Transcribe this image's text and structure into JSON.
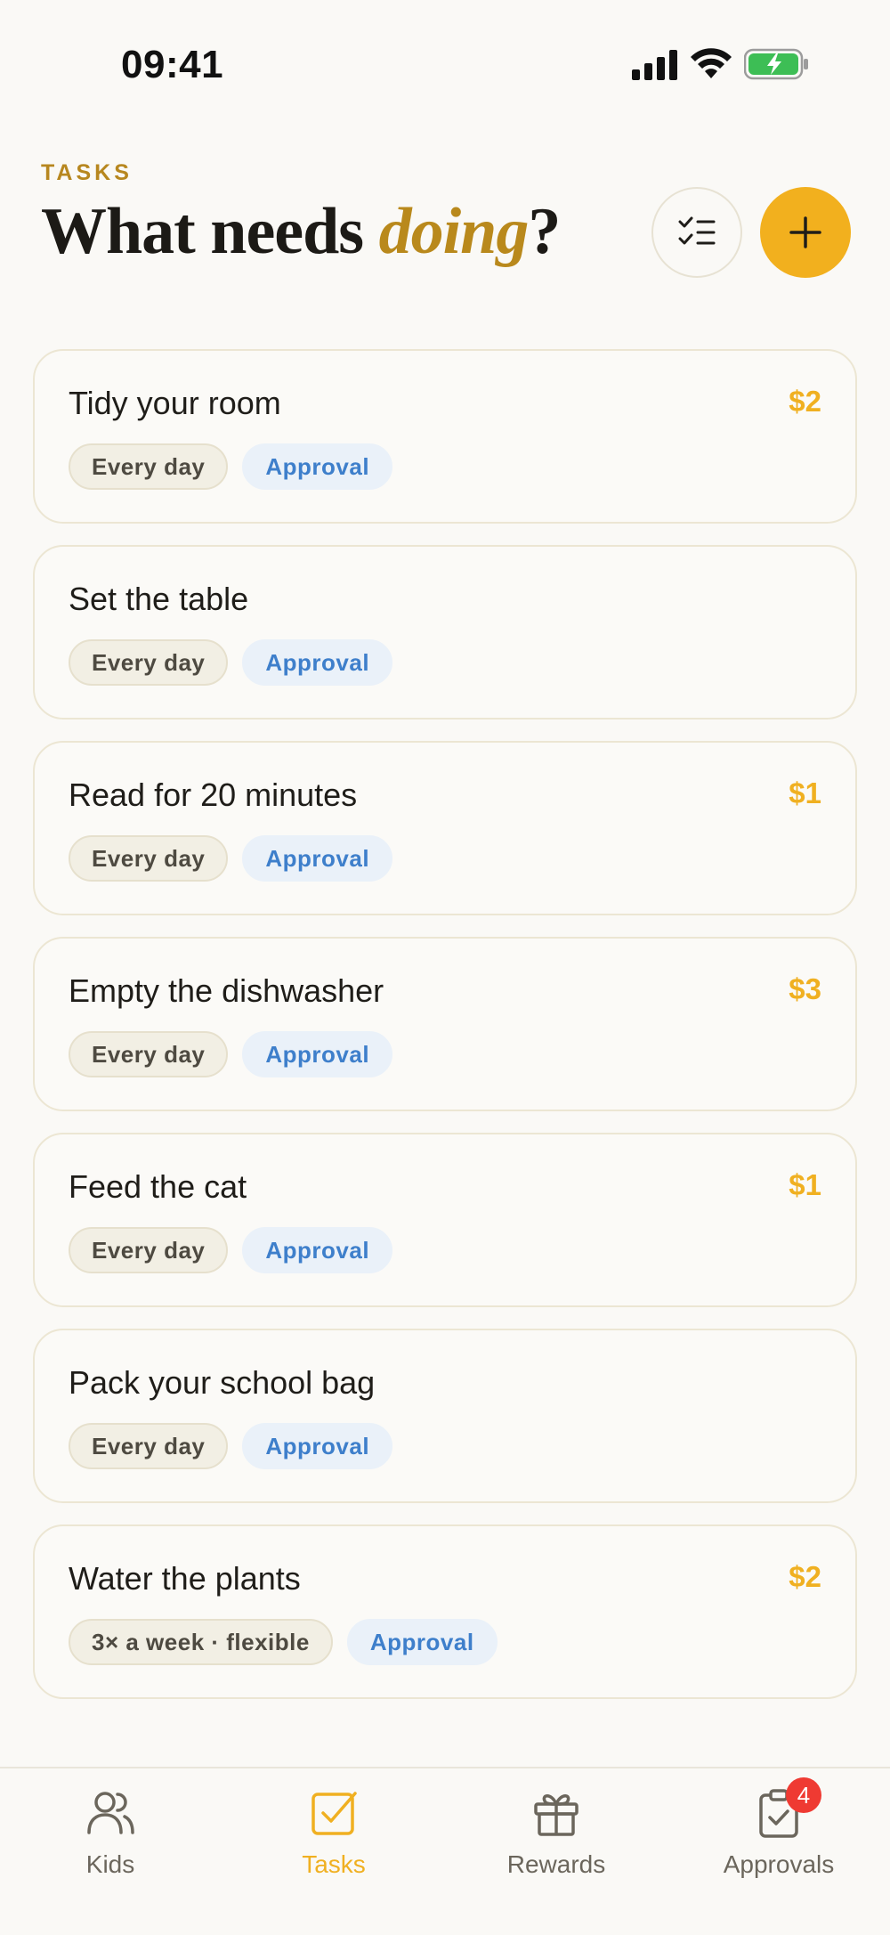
{
  "status_bar": {
    "time": "09:41"
  },
  "header": {
    "eyebrow": "TASKS",
    "title_part1": "What needs ",
    "title_accent": "doing",
    "title_part2": "?"
  },
  "tasks": [
    {
      "title": "Tidy your room",
      "price": "$2",
      "schedule": "Every day",
      "approval": "Approval"
    },
    {
      "title": "Set the table",
      "price": "",
      "schedule": "Every day",
      "approval": "Approval"
    },
    {
      "title": "Read for 20 minutes",
      "price": "$1",
      "schedule": "Every day",
      "approval": "Approval"
    },
    {
      "title": "Empty the dishwasher",
      "price": "$3",
      "schedule": "Every day",
      "approval": "Approval"
    },
    {
      "title": "Feed the cat",
      "price": "$1",
      "schedule": "Every day",
      "approval": "Approval"
    },
    {
      "title": "Pack your school bag",
      "price": "",
      "schedule": "Every day",
      "approval": "Approval"
    },
    {
      "title": "Water the plants",
      "price": "$2",
      "schedule": "3× a week · flexible",
      "approval": "Approval"
    }
  ],
  "nav": {
    "items": [
      {
        "label": "Kids",
        "icon": "users-icon",
        "active": false
      },
      {
        "label": "Tasks",
        "icon": "checkbox-icon",
        "active": true
      },
      {
        "label": "Rewards",
        "icon": "gift-icon",
        "active": false
      },
      {
        "label": "Approvals",
        "icon": "clipboard-check-icon",
        "active": false,
        "badge": "4"
      }
    ]
  },
  "colors": {
    "accent": "#F2B01E",
    "accent_text": "#B9891C",
    "approval_text": "#3E7FCB",
    "badge": "#EF3A32",
    "background": "#FAF9F6"
  }
}
